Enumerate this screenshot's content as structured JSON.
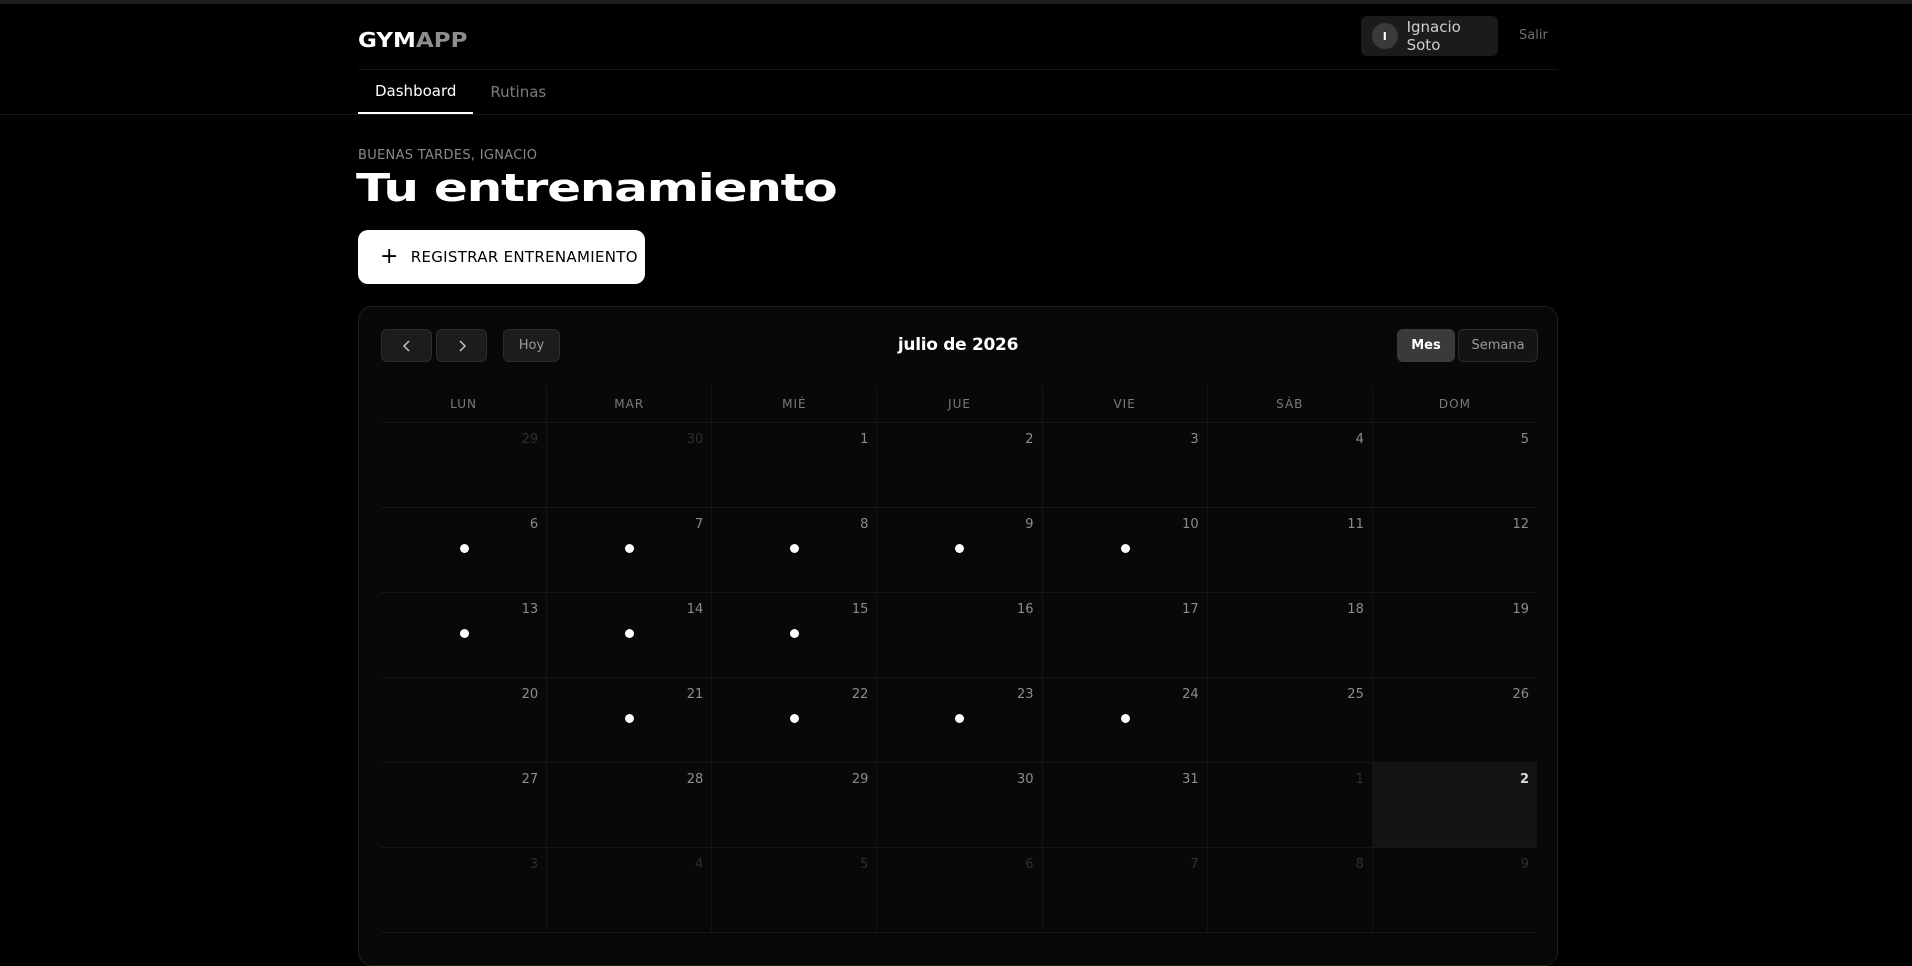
{
  "brand": {
    "part1": "GYM",
    "part2": "APP"
  },
  "user": {
    "initial": "I",
    "name": "Ignacio Soto",
    "logout_label": "Salir"
  },
  "tabs": [
    {
      "label": "Dashboard",
      "active": true
    },
    {
      "label": "Rutinas",
      "active": false
    }
  ],
  "hero": {
    "greeting": "BUENAS TARDES, IGNACIO",
    "title": "Tu entrenamiento",
    "register_label": "REGISTRAR ENTRENAMIENTO"
  },
  "calendar": {
    "month_label": "julio de 2026",
    "today_label": "Hoy",
    "views": [
      {
        "label": "Mes",
        "active": true
      },
      {
        "label": "Semana",
        "active": false
      }
    ],
    "weekdays": [
      "LUN",
      "MAR",
      "MIÉ",
      "JUE",
      "VIE",
      "SÁB",
      "DOM"
    ],
    "weeks": [
      [
        {
          "day": "29",
          "muted": true
        },
        {
          "day": "30",
          "muted": true
        },
        {
          "day": "1"
        },
        {
          "day": "2"
        },
        {
          "day": "3"
        },
        {
          "day": "4"
        },
        {
          "day": "5"
        }
      ],
      [
        {
          "day": "6",
          "workout": true
        },
        {
          "day": "7",
          "workout": true
        },
        {
          "day": "8",
          "workout": true
        },
        {
          "day": "9",
          "workout": true
        },
        {
          "day": "10",
          "workout": true
        },
        {
          "day": "11"
        },
        {
          "day": "12"
        }
      ],
      [
        {
          "day": "13",
          "workout": true
        },
        {
          "day": "14",
          "workout": true
        },
        {
          "day": "15",
          "workout": true
        },
        {
          "day": "16"
        },
        {
          "day": "17"
        },
        {
          "day": "18"
        },
        {
          "day": "19"
        }
      ],
      [
        {
          "day": "20"
        },
        {
          "day": "21",
          "workout": true
        },
        {
          "day": "22",
          "workout": true
        },
        {
          "day": "23",
          "workout": true
        },
        {
          "day": "24",
          "workout": true
        },
        {
          "day": "25"
        },
        {
          "day": "26"
        }
      ],
      [
        {
          "day": "27"
        },
        {
          "day": "28"
        },
        {
          "day": "29"
        },
        {
          "day": "30"
        },
        {
          "day": "31"
        },
        {
          "day": "1",
          "muted": true
        },
        {
          "day": "2",
          "today": true
        }
      ],
      [
        {
          "day": "3",
          "muted": true
        },
        {
          "day": "4",
          "muted": true
        },
        {
          "day": "5",
          "muted": true
        },
        {
          "day": "6",
          "muted": true
        },
        {
          "day": "7",
          "muted": true
        },
        {
          "day": "8",
          "muted": true
        },
        {
          "day": "9",
          "muted": true
        }
      ]
    ]
  },
  "icons": {
    "prev": "chevron-left-icon",
    "next": "chevron-right-icon",
    "add": "plus-icon"
  },
  "colors": {
    "background": "#000000",
    "accent": "#ffffff",
    "workout_dot": "#ffffff"
  }
}
